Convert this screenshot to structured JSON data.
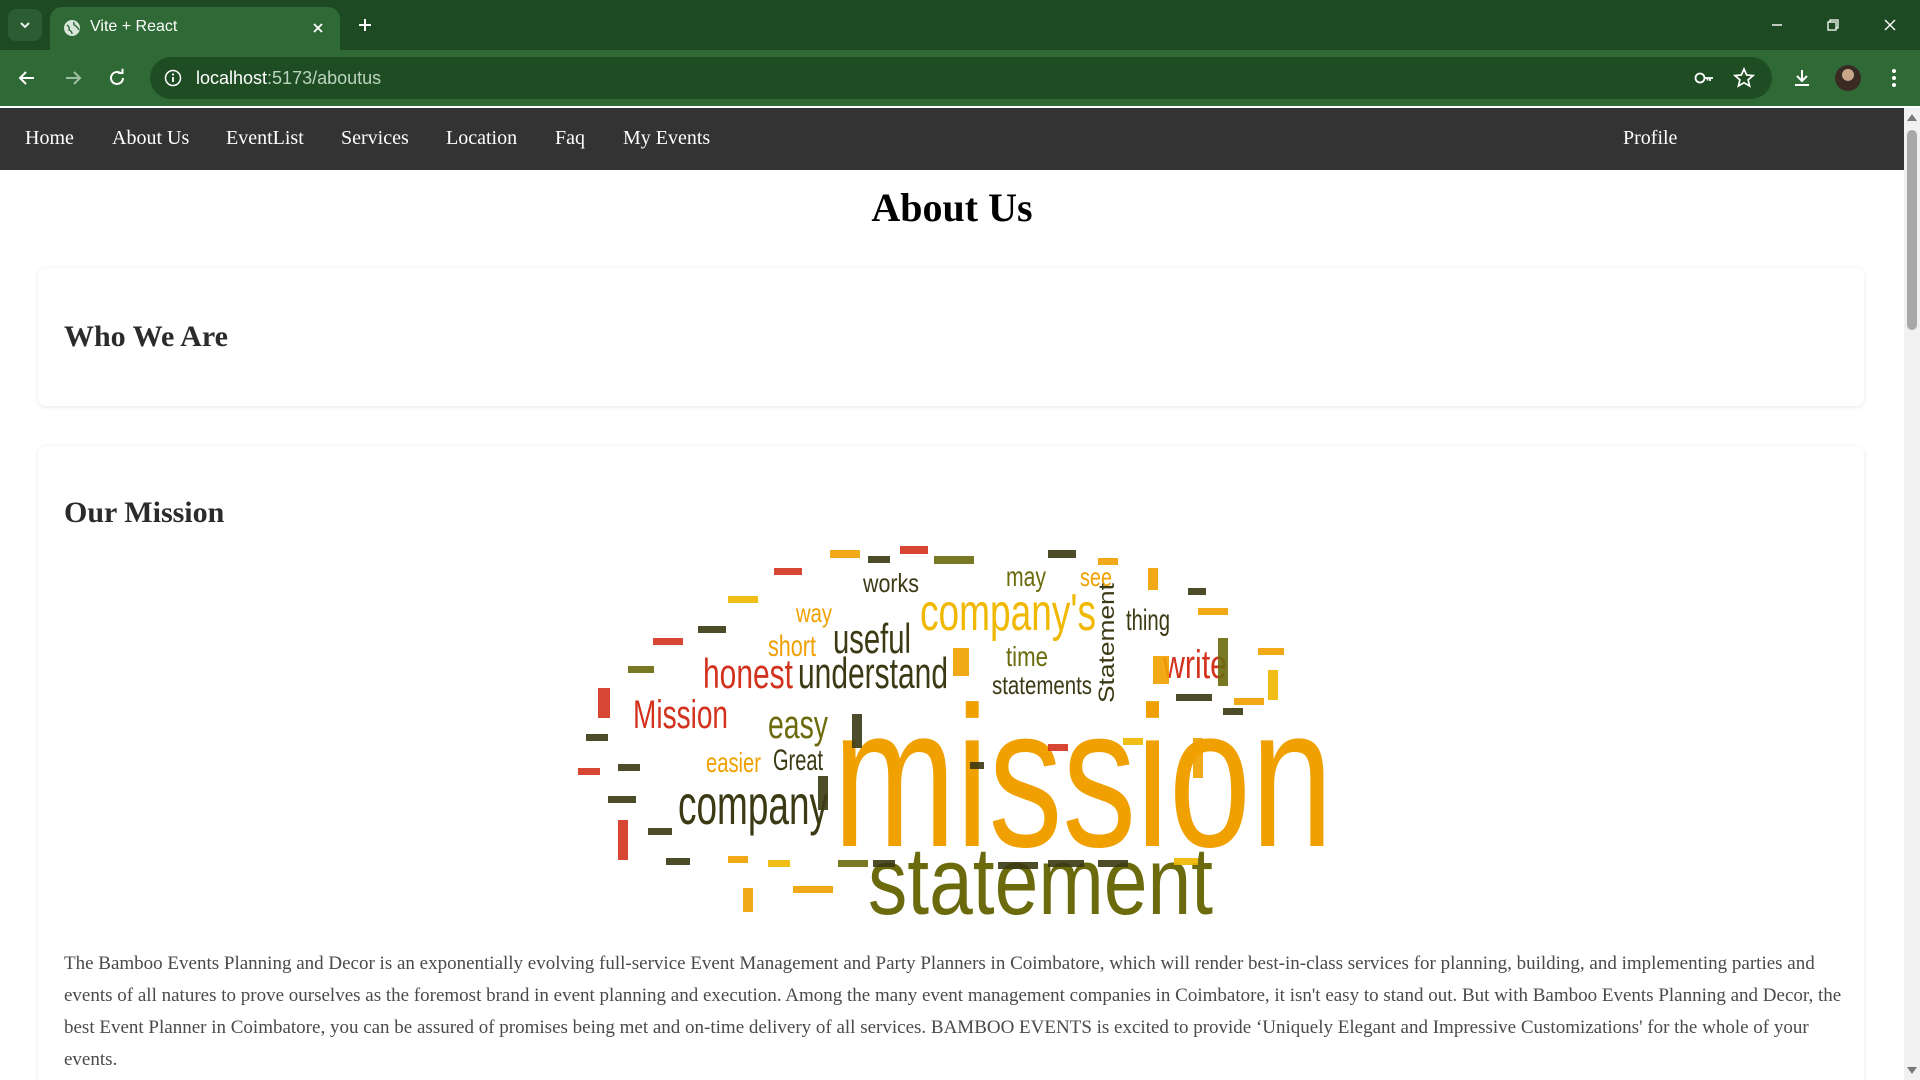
{
  "browser": {
    "tab": {
      "title": "Vite + React"
    },
    "address": {
      "host": "localhost",
      "path": ":5173/aboutus"
    }
  },
  "navbar": {
    "links": [
      "Home",
      "About Us",
      "EventList",
      "Services",
      "Location",
      "Faq",
      "My Events"
    ],
    "profile": "Profile"
  },
  "page": {
    "title": "About Us",
    "who_we_are": {
      "heading": "Who We Are"
    },
    "mission": {
      "heading": "Our Mission",
      "image_words": {
        "main": "mission",
        "statement": "statement",
        "company": "company",
        "companys": "company's",
        "understand": "understand",
        "honest": "honest",
        "useful": "useful",
        "mission_word": "Mission",
        "easy": "easy",
        "easier": "easier",
        "great": "Great",
        "write": "write",
        "works": "works",
        "may": "may",
        "see": "see",
        "time": "time",
        "statements": "statements",
        "short": "short",
        "way": "way",
        "thing": "thing",
        "statement_v": "Statement"
      },
      "paragraph": "The Bamboo Events Planning and Decor is an exponentially evolving full-service Event Management and Party Planners in Coimbatore, which will render best-in-class services for planning, building, and implementing parties and events of all natures to prove ourselves as the foremost brand in event planning and execution. Among the many event management companies in Coimbatore, it isn't easy to stand out. But with Bamboo Events Planning and Decor, the best Event Planner in Coimbatore, you can be assured of promises being met and on-time delivery of all services. BAMBOO EVENTS is excited to provide ‘Uniquely Elegant and Impressive Customizations' for the whole of your events."
    }
  },
  "colors": {
    "chrome_dark": "#1d4a22",
    "chrome_mid": "#2f6a36",
    "navbar": "#333333",
    "cloud_orange": "#f0a000",
    "cloud_olive": "#6b6a0c",
    "cloud_dark": "#3b3a14",
    "cloud_red": "#d2321e"
  }
}
